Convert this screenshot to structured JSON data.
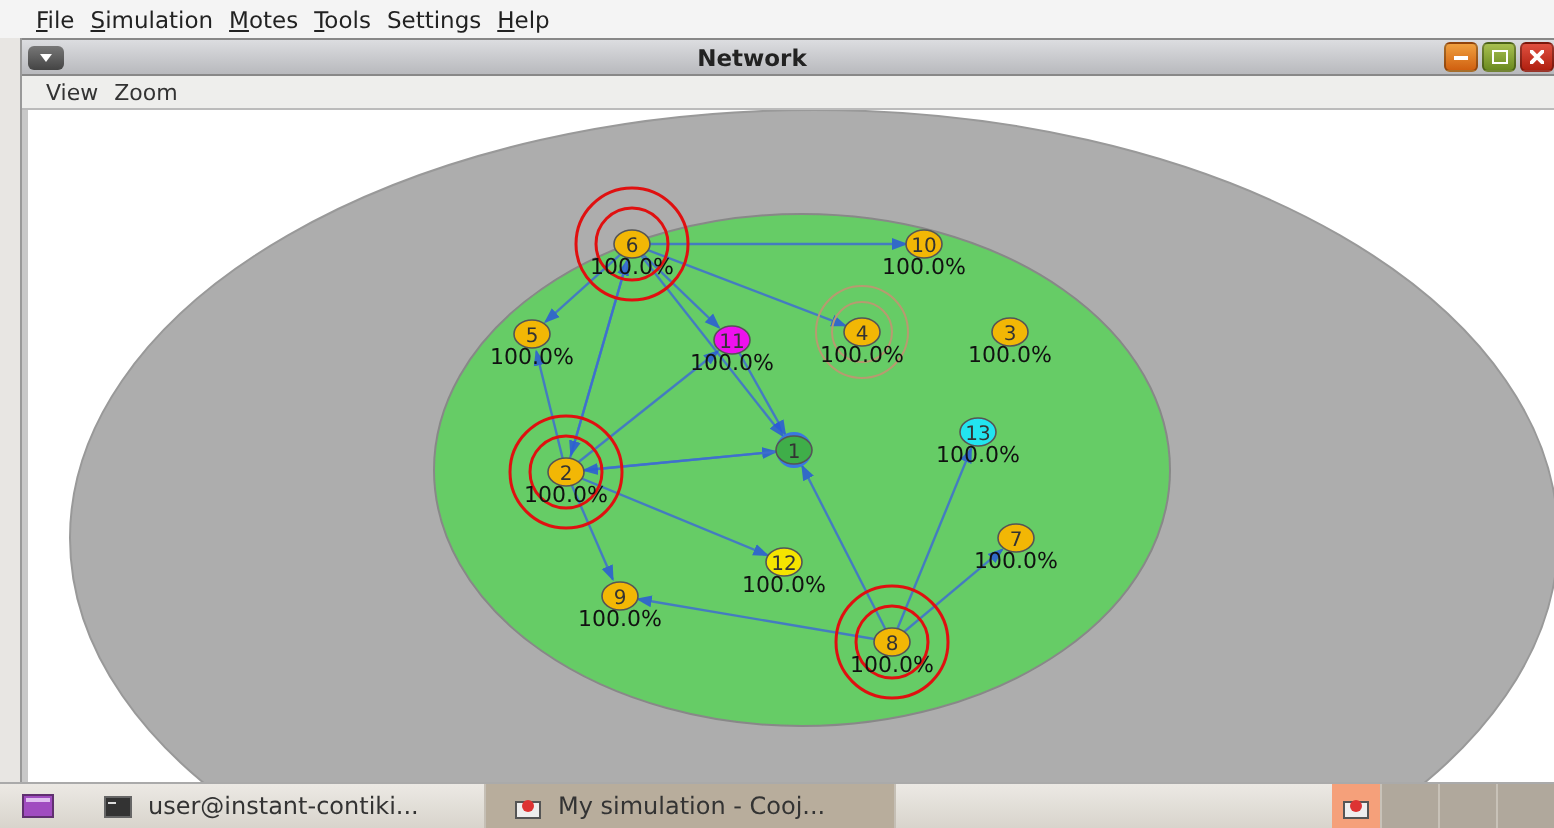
{
  "menu": [
    {
      "label": "File",
      "mnemonic": true
    },
    {
      "label": "Simulation",
      "mnemonic": true
    },
    {
      "label": "Motes",
      "mnemonic": true
    },
    {
      "label": "Tools",
      "mnemonic": true
    },
    {
      "label": "Settings",
      "mnemonic": false
    },
    {
      "label": "Help",
      "mnemonic": true
    }
  ],
  "window": {
    "title": "Network",
    "menu": [
      "View",
      "Zoom"
    ]
  },
  "motes": [
    {
      "label": "6",
      "reading": "100.0%",
      "color": "#f2b705",
      "kind": "transmitting"
    },
    {
      "label": "10",
      "reading": "100.0%",
      "color": "#f2b705",
      "kind": "idle"
    },
    {
      "label": "5",
      "reading": "100.0%",
      "color": "#f2b705",
      "kind": "idle"
    },
    {
      "label": "11",
      "reading": "100.0%",
      "color": "#ee11ee",
      "kind": "idle"
    },
    {
      "label": "4",
      "reading": "100.0%",
      "color": "#f2b705",
      "kind": "interfered"
    },
    {
      "label": "3",
      "reading": "100.0%",
      "color": "#f2b705",
      "kind": "idle"
    },
    {
      "label": "1",
      "color": "#3fae49",
      "kind": "listening"
    },
    {
      "label": "13",
      "reading": "100.0%",
      "color": "#22e4f0",
      "kind": "idle"
    },
    {
      "label": "2",
      "reading": "100.0%",
      "color": "#f2b705",
      "kind": "transmitting"
    },
    {
      "label": "7",
      "reading": "100.0%",
      "color": "#f2b705",
      "kind": "idle"
    },
    {
      "label": "12",
      "reading": "100.0%",
      "color": "#f5e400",
      "kind": "idle"
    },
    {
      "label": "9",
      "reading": "100.0%",
      "color": "#f2b705",
      "kind": "idle"
    },
    {
      "label": "8",
      "reading": "100.0%",
      "color": "#f2b705",
      "kind": "transmitting"
    }
  ],
  "taskbar": {
    "tasks": [
      {
        "label": "user@instant-contiki...",
        "kind": "terminal",
        "selected": false
      },
      {
        "label": "My simulation - Cooj...",
        "kind": "cooja",
        "selected": true
      }
    ]
  }
}
